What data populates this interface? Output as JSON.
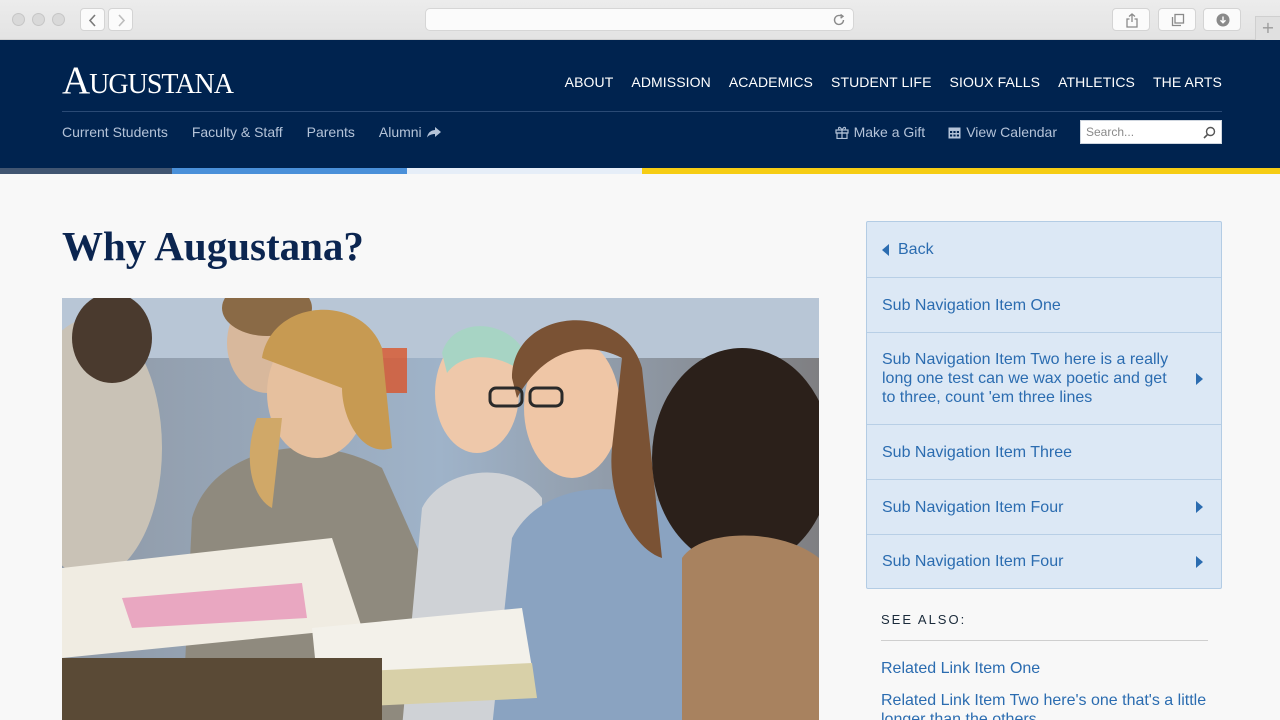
{
  "browser": {
    "icons": [
      "back-icon",
      "forward-icon",
      "reload-icon",
      "share-icon",
      "tabs-icon",
      "download-icon",
      "plus-icon"
    ],
    "new_tab_glyph": "+"
  },
  "header": {
    "logo": {
      "cap": "A",
      "rest": "UGUSTANA"
    },
    "main_nav": [
      "ABOUT",
      "ADMISSION",
      "ACADEMICS",
      "STUDENT LIFE",
      "SIOUX FALLS",
      "ATHLETICS",
      "THE ARTS"
    ],
    "sub_nav": [
      "Current Students",
      "Faculty & Staff",
      "Parents",
      "Alumni"
    ],
    "make_gift": "Make a Gift",
    "view_calendar": "View Calendar",
    "search_placeholder": "Search..."
  },
  "stripe_colors": [
    "#415571",
    "#4a90d9",
    "#e6eef8",
    "#f6cd14"
  ],
  "colors": {
    "navy": "#00234f",
    "link_blue": "#2b6cb0",
    "sidenav_bg": "#dce8f5"
  },
  "main": {
    "title": "Why Augustana?"
  },
  "sidebar": {
    "back": "Back",
    "items": [
      {
        "label": "Sub Navigation Item One",
        "has_children": false
      },
      {
        "label": "Sub Navigation Item Two here is a really long one test can we wax poetic and get to three, count 'em three lines",
        "has_children": true
      },
      {
        "label": "Sub Navigation Item Three",
        "has_children": false
      },
      {
        "label": "Sub Navigation Item Four",
        "has_children": true
      },
      {
        "label": "Sub Navigation Item Four",
        "has_children": true
      }
    ],
    "see_also_heading": "SEE ALSO:",
    "related": [
      "Related Link Item One",
      "Related Link Item Two here's one that's a little longer than the others"
    ]
  }
}
